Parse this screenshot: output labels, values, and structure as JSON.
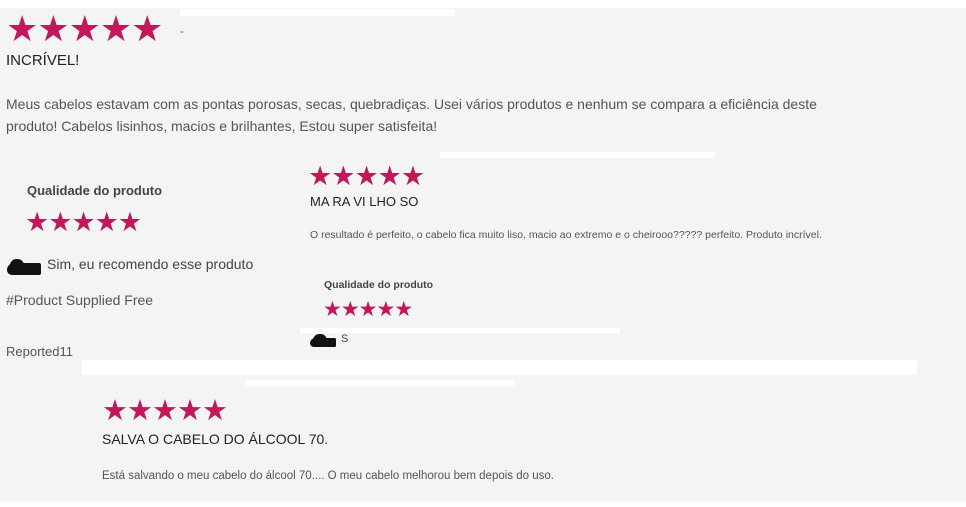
{
  "review1": {
    "title": "INCRÍVEL!",
    "dash": "-",
    "body_line1": "Meus cabelos estavam com as pontas porosas, secas, quebradiças. Usei vários produtos e nenhum se compara a eficiência deste",
    "body_line2": "produto! Cabelos lisinhos, macios e brilhantes, Estou super satisfeita!",
    "quality_label": "Qualidade do produto",
    "recommend_text": "Sim, eu recomendo esse produto",
    "supplied_text": "#Product Supplied Free",
    "reported_text": "Reported11",
    "rating": 5,
    "quality_rating": 5
  },
  "review2": {
    "title": "MA RA VI LHO SO",
    "body": "O resultado é perfeito, o cabelo fica muito liso, macio ao extremo e o cheirooo????? perfeito. Produto incrível.",
    "quality_label": "Qualidade do produto",
    "recommend_text": "S",
    "rating": 5,
    "quality_rating": 5
  },
  "review3": {
    "title": "SALVA O CABELO DO ÁLCOOL 70.",
    "body": "Está salvando o meu cabelo do álcool 70.... O meu cabelo melhorou bem depois do uso.",
    "rating": 5
  },
  "colors": {
    "star": "#c2185b",
    "background": "#f4f4f4"
  },
  "icons": {
    "star": "★",
    "recommend": "shoe-icon"
  }
}
